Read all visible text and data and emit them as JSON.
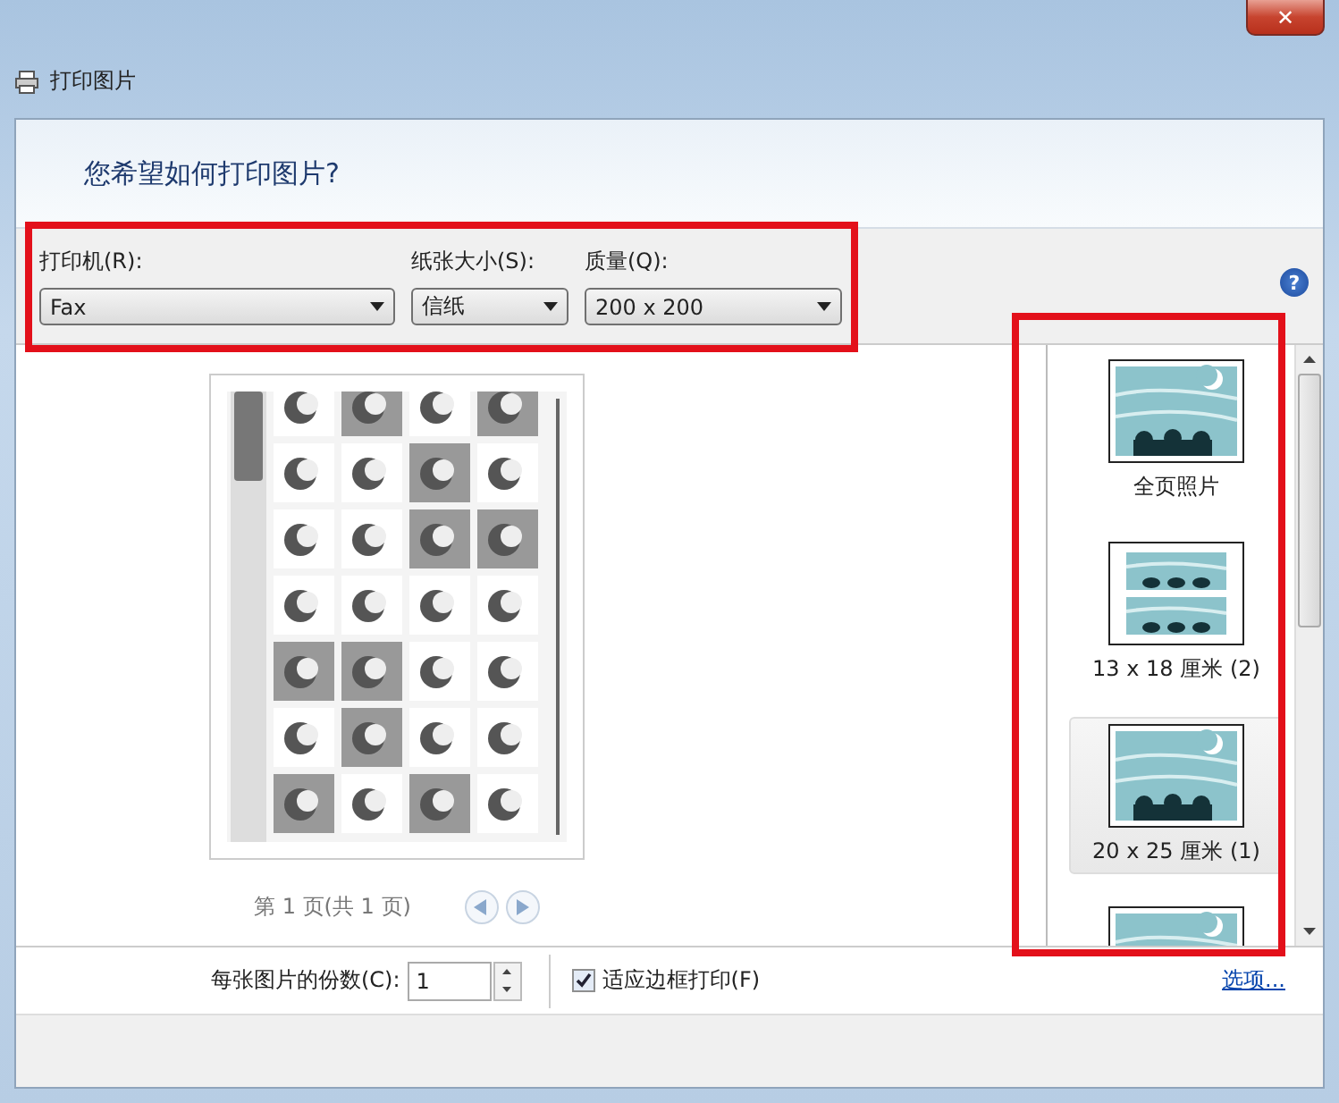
{
  "window": {
    "title": "打印图片",
    "close_label": "✕"
  },
  "header": {
    "question": "您希望如何打印图片?"
  },
  "settings": {
    "highlighted": true,
    "help_icon": "?",
    "fields": [
      {
        "label": "打印机(R):",
        "value": "Fax"
      },
      {
        "label": "纸张大小(S):",
        "value": "信纸"
      },
      {
        "label": "质量(Q):",
        "value": "200 x 200"
      }
    ]
  },
  "preview": {
    "kind": "picture",
    "page_info": "第 1 页(共 1 页)"
  },
  "layouts": {
    "highlighted": true,
    "items": [
      {
        "label": "全页照片",
        "kind": "full",
        "selected": false
      },
      {
        "label": "13 x 18 厘米 (2)",
        "kind": "two",
        "selected": false
      },
      {
        "label": "20 x 25 厘米 (1)",
        "kind": "full",
        "selected": true
      },
      {
        "kind": "full",
        "selected": false
      }
    ]
  },
  "options": {
    "copies_label": "每张图片的份数(C):",
    "copies": "1",
    "fit": {
      "label": "适应边框打印(F)",
      "checked": true
    },
    "link": "选项..."
  }
}
